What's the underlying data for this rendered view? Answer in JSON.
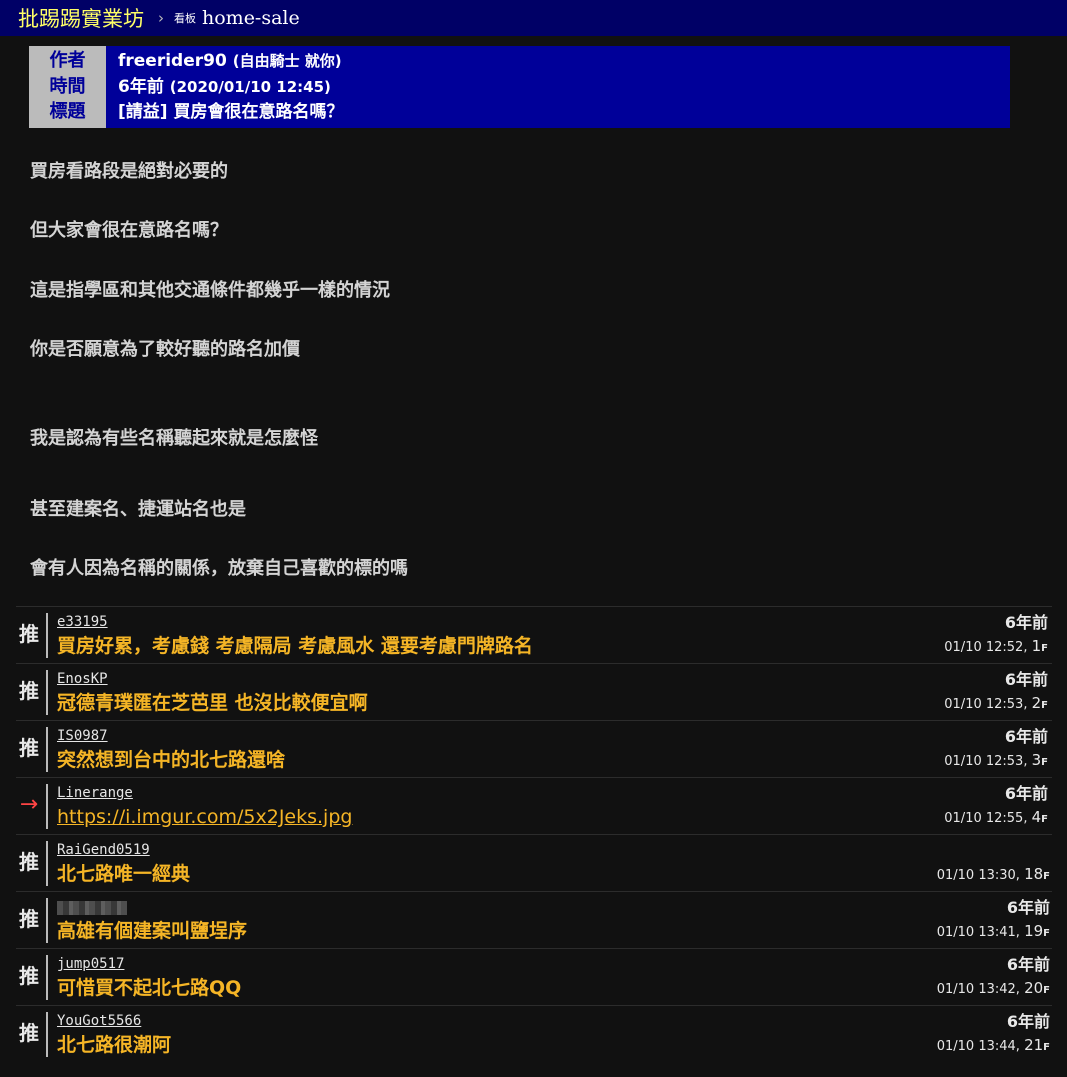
{
  "site": {
    "title": "批踢踢實業坊",
    "crumb_sep": "›",
    "board_label": "看板",
    "board": "home-sale"
  },
  "article": {
    "labels": {
      "author": "作者",
      "time": "時間",
      "title": "標題"
    },
    "author": "freerider90",
    "author_nick": "(自由騎士 就你)",
    "time_ago": "6年前",
    "time_full": "(2020/01/10 12:45)",
    "title": "[請益] 買房會很在意路名嗎？",
    "paragraphs": [
      "買房看路段是絕對必要的",
      "但大家會很在意路名嗎？",
      "這是指學區和其他交通條件都幾乎一樣的情況",
      "你是否願意為了較好聽的路名加價",
      "我是認為有些名稱聽起來就是怎麼怪",
      "甚至建案名、捷運站名也是",
      "會有人因為名稱的關係，放棄自己喜歡的標的嗎"
    ]
  },
  "comments": [
    {
      "tag": "推",
      "user": "e33195",
      "content": "買房好累，考慮錢 考慮隔局 考慮風水 還要考慮門牌路名",
      "ago": "6年前",
      "time": "01/10 12:52,",
      "floor": "1",
      "floor_suffix": "F"
    },
    {
      "tag": "推",
      "user": "EnosKP",
      "content": "冠德青璞匯在芝芭里 也沒比較便宜啊",
      "ago": "6年前",
      "time": "01/10 12:53,",
      "floor": "2",
      "floor_suffix": "F"
    },
    {
      "tag": "推",
      "user": "IS0987",
      "content": "突然想到台中的北七路還啥",
      "ago": "6年前",
      "time": "01/10 12:53,",
      "floor": "3",
      "floor_suffix": "F"
    },
    {
      "tag": "→",
      "user": "Linerange",
      "content": "https://i.imgur.com/5x2Jeks.jpg",
      "ago": "6年前",
      "time": "01/10 12:55,",
      "floor": "4",
      "floor_suffix": "F"
    },
    {
      "tag": "推",
      "user": "RaiGend0519",
      "content": "北七路唯一經典",
      "ago": "",
      "time": "01/10 13:30,",
      "floor": "18",
      "floor_suffix": "F"
    },
    {
      "tag": "推",
      "user": "",
      "content": "高雄有個建案叫鹽埕序",
      "ago": "6年前",
      "time": "01/10 13:41,",
      "floor": "19",
      "floor_suffix": "F"
    },
    {
      "tag": "推",
      "user": "jump0517",
      "content": "可惜買不起北七路QQ",
      "ago": "6年前",
      "time": "01/10 13:42,",
      "floor": "20",
      "floor_suffix": "F"
    },
    {
      "tag": "推",
      "user": "YouGot5566",
      "content": "北七路很潮阿",
      "ago": "6年前",
      "time": "01/10 13:44,",
      "floor": "21",
      "floor_suffix": "F"
    }
  ]
}
